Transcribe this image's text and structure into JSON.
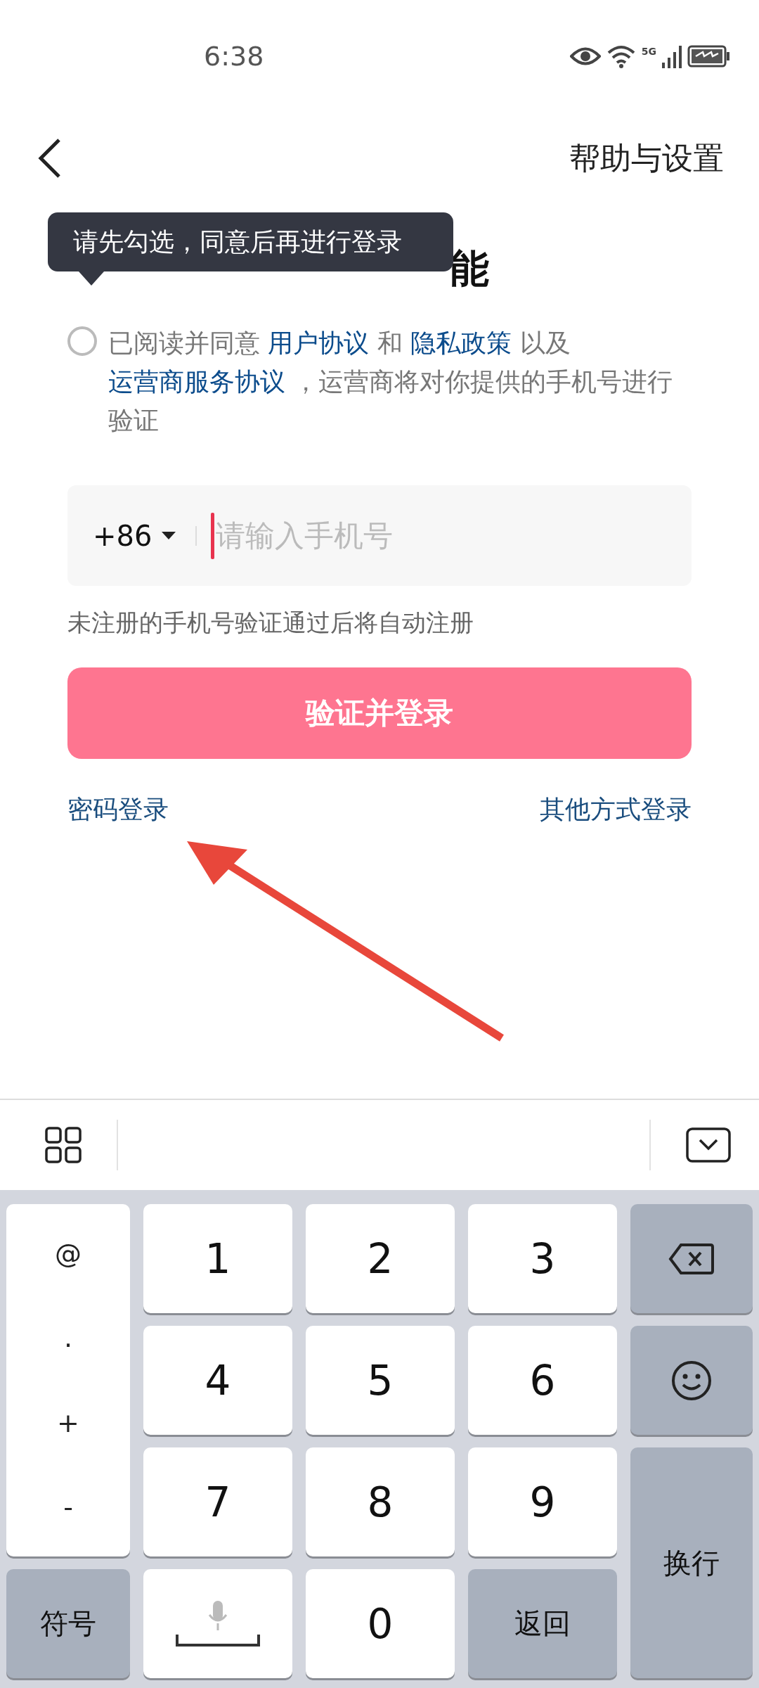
{
  "status_bar": {
    "time": "6:38",
    "network": "5G",
    "charging": true
  },
  "nav": {
    "action": "帮助与设置"
  },
  "title_visible_part": "能",
  "tooltip": "请先勾选，同意后再进行登录",
  "agreement": {
    "checked": false,
    "segments": [
      {
        "text": "已阅读并同意 ",
        "link": false
      },
      {
        "text": "用户协议",
        "link": true
      },
      {
        "text": " 和 ",
        "link": false
      },
      {
        "text": "隐私政策",
        "link": true
      },
      {
        "text": " 以及 ",
        "link": false
      },
      {
        "text": "运营商服务协议",
        "link": true
      },
      {
        "text": " ，运营商将对你提供的手机号进行验证",
        "link": false
      }
    ]
  },
  "phone": {
    "country_code": "+86",
    "placeholder": "请输入手机号"
  },
  "hint": "未注册的手机号验证通过后将自动注册",
  "submit_button": "验证并登录",
  "links": {
    "left": "密码登录",
    "right": "其他方式登录"
  },
  "annotation_arrow": true,
  "keyboard": {
    "symbols": [
      "@",
      ".",
      "+",
      "-"
    ],
    "digits": [
      "1",
      "2",
      "3",
      "4",
      "5",
      "6",
      "7",
      "8",
      "9",
      "0"
    ],
    "symbol_key": "符号",
    "return_key": "返回",
    "enter_key": "换行"
  }
}
